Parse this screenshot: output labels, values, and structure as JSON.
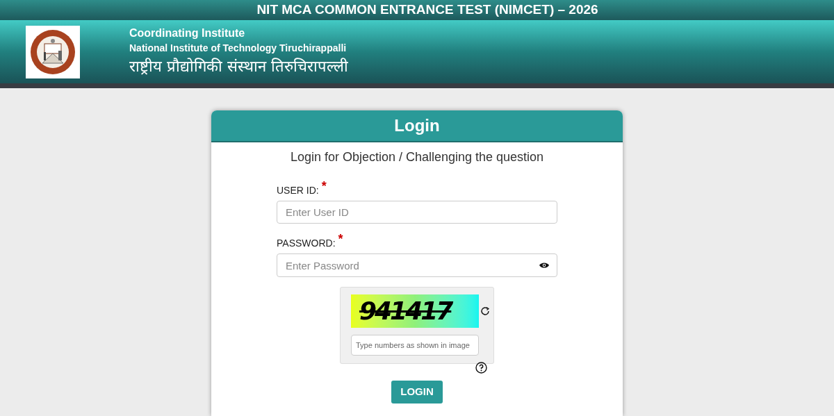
{
  "top_bar": {
    "title": "NIT MCA COMMON ENTRANCE TEST (NIMCET) – 2026"
  },
  "header": {
    "line_1": "Coordinating Institute",
    "line_2": "National Institute of Technology Tiruchirappalli",
    "line_3": "राष्ट्रीय प्रौद्योगिकी संस्थान तिरुचिरापल्ली"
  },
  "login_card": {
    "title": "Login",
    "subtitle": "Login for Objection / Challenging the question",
    "fields": [
      {
        "label": "USER ID:",
        "required_mark": "*",
        "placeholder": "Enter User ID",
        "kind": "text"
      },
      {
        "label": "PASSWORD:",
        "required_mark": "*",
        "placeholder": "Enter Password",
        "kind": "password"
      }
    ],
    "captcha": {
      "code": "941417",
      "placeholder": "Type numbers as shown in image"
    },
    "button": "LOGIN"
  }
}
